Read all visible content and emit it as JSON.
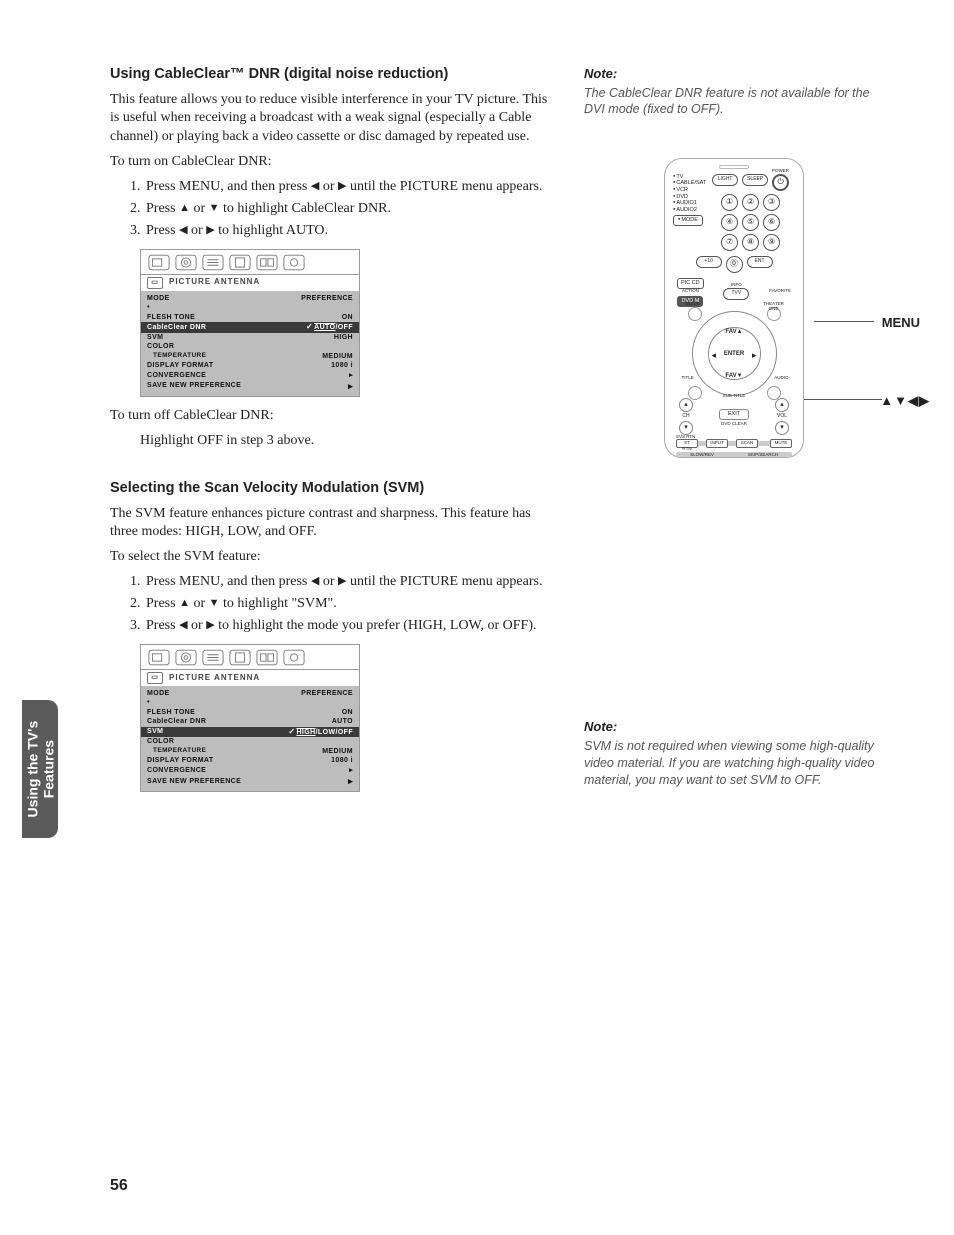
{
  "page_number": "56",
  "section_tab": "Using the TV's\nFeatures",
  "section1": {
    "heading": "Using CableClear™ DNR (digital noise reduction)",
    "intro": "This feature allows you to reduce visible interference in your TV picture. This is useful when receiving a broadcast with a weak signal (especially a Cable channel) or playing back a video cassette or disc damaged by repeated use.",
    "lead": "To turn on CableClear DNR:",
    "steps": [
      "Press MENU, and then press ◀ or ▶ until the PICTURE menu appears.",
      "Press ▲ or ▼ to highlight CableClear DNR.",
      "Press ◀ or ▶ to highlight AUTO."
    ],
    "off_lead": "To turn off CableClear DNR:",
    "off_step": "Highlight OFF in step 3 above."
  },
  "section2": {
    "heading": "Selecting the Scan Velocity Modulation (SVM)",
    "intro": "The SVM feature enhances picture contrast and sharpness. This feature has three modes: HIGH, LOW, and OFF.",
    "lead": "To select the SVM feature:",
    "steps": [
      "Press MENU, and then press ◀ or ▶ until the PICTURE menu appears.",
      "Press ▲ or ▼ to highlight \"SVM\".",
      "Press ◀ or ▶ to highlight the mode you prefer (HIGH, LOW, or OFF)."
    ]
  },
  "osd1": {
    "header": "PICTURE  ANTENNA",
    "mode": "MODE",
    "pref": "PREFERENCE",
    "flesh": "FLESH  TONE",
    "flesh_v": "ON",
    "cc": "CableClear  DNR",
    "cc_v": "AUTO",
    "cc_opts": "/OFF",
    "svm": "SVM",
    "svm_v": "HIGH",
    "colortemp": "COLOR\n  TEMPERATURE",
    "colortemp_v": "MEDIUM",
    "display": "DISPLAY  FORMAT",
    "display_v": "1080 i",
    "conv": "CONVERGENCE",
    "save": "SAVE  NEW    PREFERENCE"
  },
  "osd2": {
    "header": "PICTURE  ANTENNA",
    "mode": "MODE",
    "pref": "PREFERENCE",
    "flesh": "FLESH  TONE",
    "flesh_v": "ON",
    "cc": "CableClear  DNR",
    "cc_v": "AUTO",
    "svm": "SVM",
    "svm_v": "HIGH",
    "svm_opts": "/LOW/OFF",
    "colortemp": "COLOR\n  TEMPERATURE",
    "colortemp_v": "MEDIUM",
    "display": "DISPLAY  FORMAT",
    "display_v": "1080 i",
    "conv": "CONVERGENCE",
    "save": "SAVE  NEW    PREFERENCE"
  },
  "side_note1": {
    "heading": "Note:",
    "text": "The CableClear DNR feature is not available for the DVI mode (fixed to OFF)."
  },
  "side_note2": {
    "heading": "Note:",
    "text": "SVM is not required when viewing some high-quality video material. If you are watching high-quality video material, you may want to set SVM to OFF."
  },
  "remote": {
    "callout_menu": "MENU",
    "callout_arrows": "▲▼◀▶",
    "devices": [
      "TV",
      "CABLE/SAT",
      "VCR",
      "DVD",
      "AUDIO1",
      "AUDIO2"
    ],
    "top_buttons": [
      "LIGHT",
      "SLEEP"
    ],
    "power_label": "POWER",
    "numpad": [
      "1",
      "2",
      "3",
      "4",
      "5",
      "6",
      "7",
      "8",
      "9",
      "",
      "0",
      ""
    ],
    "btn_100": "+10",
    "btn_ent": "ENT",
    "mode_btn": "MODE",
    "piccd": "PIC CD",
    "action": "ACTION",
    "dvdm": "DVD M",
    "tvvcr": "TVV",
    "info": "INFO",
    "favorite": "FAVORITE",
    "guide": "GUIDE",
    "title": "TITLE",
    "subtitle": "SUB TITLE",
    "audio": "AUDIO",
    "theater": "THEATER ONE",
    "enter": "ENTER",
    "fav_up": "FAV▲",
    "fav_dn": "FAV▼",
    "ch": "CH",
    "vol": "VOL",
    "exit": "EXIT",
    "dvdclear": "DVD CLEAR",
    "svsrtn": "SVS RTN",
    "strtn": "ST RTN",
    "input": "INPUT",
    "scan": "SCAN",
    "mute": "MUTE",
    "slowrev": "SLOW/REV",
    "skipsearch": "SKIP/SEARCH"
  }
}
